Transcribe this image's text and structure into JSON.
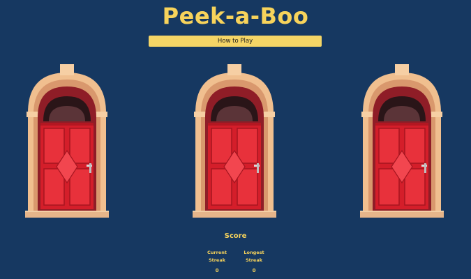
{
  "game": {
    "title": "Peek-a-Boo",
    "how_to_play_label": "How to Play"
  },
  "doors": [
    {
      "name": "door-1"
    },
    {
      "name": "door-2"
    },
    {
      "name": "door-3"
    }
  ],
  "score": {
    "title": "Score",
    "current_label_line1": "Current",
    "current_label_line2": "Streak",
    "current_value": "0",
    "longest_label_line1": "Longest",
    "longest_label_line2": "Streak",
    "longest_value": "0"
  },
  "colors": {
    "background": "#163861",
    "accent": "#f7d35b",
    "door_red": "#e0232f"
  }
}
